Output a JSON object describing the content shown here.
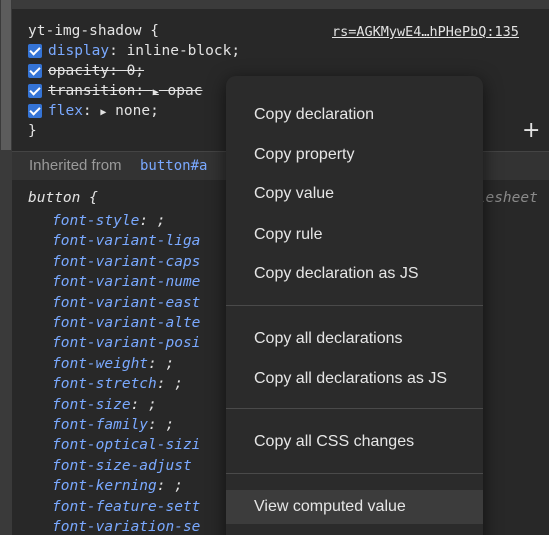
{
  "styles": {
    "rule1": {
      "selector": "yt-img-shadow {",
      "source_link": "rs=AGKMywE4…hPHePbQ:135",
      "close": "}",
      "declarations": [
        {
          "name": "display",
          "value": "inline-block;",
          "checked": true,
          "struck": false
        },
        {
          "name": "opacity",
          "value": "0;",
          "checked": true,
          "struck": true
        },
        {
          "name": "transition",
          "value": "opac",
          "checked": true,
          "struck": true,
          "expandable": true
        },
        {
          "name": "flex",
          "value": "none;",
          "checked": true,
          "struck": false,
          "expandable": true
        }
      ]
    },
    "inherited": {
      "label": "Inherited from",
      "ref": "button#a"
    },
    "rule2": {
      "selector": "button {",
      "source_partial": "ylesheet",
      "declarations": [
        {
          "name": "font-style",
          "value": ";"
        },
        {
          "name": "font-variant-liga",
          "value": ""
        },
        {
          "name": "font-variant-caps",
          "value": ""
        },
        {
          "name": "font-variant-nume",
          "value": ""
        },
        {
          "name": "font-variant-east",
          "value": ""
        },
        {
          "name": "font-variant-alte",
          "value": ""
        },
        {
          "name": "font-variant-posi",
          "value": ""
        },
        {
          "name": "font-weight",
          "value": ";"
        },
        {
          "name": "font-stretch",
          "value": ";"
        },
        {
          "name": "font-size",
          "value": ";"
        },
        {
          "name": "font-family",
          "value": ";"
        },
        {
          "name": "font-optical-sizi",
          "value": ""
        },
        {
          "name": "font-size-adjust",
          "value": ""
        },
        {
          "name": "font-kerning",
          "value": ";"
        },
        {
          "name": "font-feature-sett",
          "value": ""
        },
        {
          "name": "font-variation-se",
          "value": ""
        }
      ]
    },
    "add_symbol": "+"
  },
  "context_menu": {
    "items": [
      "Copy declaration",
      "Copy property",
      "Copy value",
      "Copy rule",
      "Copy declaration as JS",
      "Copy all declarations",
      "Copy all declarations as JS",
      "Copy all CSS changes",
      "View computed value"
    ],
    "highlighted": "View computed value"
  }
}
